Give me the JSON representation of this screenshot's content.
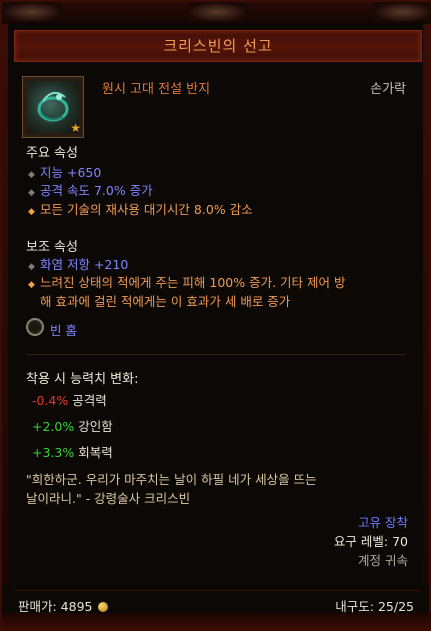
{
  "item": {
    "name": "크리스빈의 선고",
    "type": "원시 고대 전설 반지",
    "slot": "손가락",
    "icon": "ring-icon",
    "ancient_star": "★"
  },
  "primary": {
    "label": "주요 속성",
    "stats": [
      {
        "text": "지능 +650",
        "kind": "magic"
      },
      {
        "text": "공격 속도 7.0% 증가",
        "kind": "magic"
      },
      {
        "text": "모든 기술의 재사용 대기시간 8.0% 감소",
        "kind": "legendary"
      }
    ]
  },
  "secondary": {
    "label": "보조 속성",
    "stats": [
      {
        "text": "화염 저항 +210",
        "kind": "magic"
      },
      {
        "text": "느려진 상태의 적에게 주는 피해 100% 증가. 기타 제어 방",
        "kind": "legendary"
      },
      {
        "text": "해 효과에 걸린 적에게는 이 효과가 세 배로 증가",
        "kind": "legendary-cont"
      }
    ]
  },
  "socket": {
    "text": "빈 홈"
  },
  "changes": {
    "label": "착용 시 능력치 변화:",
    "rows": [
      {
        "value": "-0.4%",
        "name": "공격력",
        "sign": "neg"
      },
      {
        "value": "+2.0%",
        "name": "강인함",
        "sign": "pos"
      },
      {
        "value": "+3.3%",
        "name": "회복력",
        "sign": "pos"
      }
    ]
  },
  "flavor": {
    "line1": "\"희한하군. 우리가 마주치는 날이 하필 네가 세상을 뜨는",
    "line2": "날이라니.\" - 강령술사 크리스빈"
  },
  "info": {
    "unique": "고유 장착",
    "required_level": "요구 레벨: 70",
    "account_bound": "계정 귀속"
  },
  "footer": {
    "sell_label": "판매가: 4895",
    "durability": "내구도: 25/25"
  },
  "colors": {
    "title": "#f09b52",
    "magic": "#7f86ff",
    "legendary": "#f09a52",
    "negative": "#e03a2e",
    "positive": "#37d33a"
  }
}
